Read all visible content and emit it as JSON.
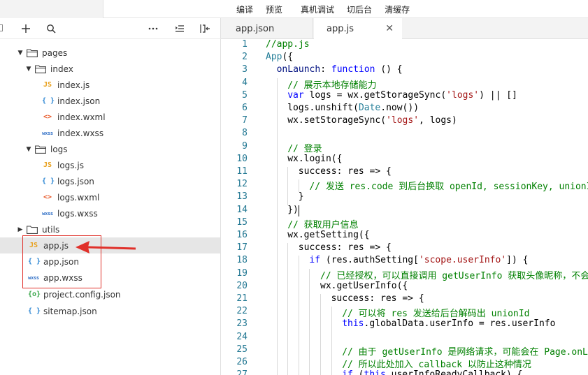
{
  "toolbar": {
    "menu": [
      "编译",
      "预览",
      "真机调试",
      "切后台",
      "清缓存"
    ]
  },
  "explorer_toolbar": {
    "icons": [
      "add-icon",
      "search-icon",
      "more-icon",
      "collapse-icon",
      "split-icon"
    ]
  },
  "explorer": {
    "tree": [
      {
        "label": "pages",
        "type": "folder",
        "depth": 0
      },
      {
        "label": "index",
        "type": "folder",
        "depth": 1
      },
      {
        "label": "index.js",
        "type": "js",
        "depth": 2
      },
      {
        "label": "index.json",
        "type": "json",
        "depth": 2
      },
      {
        "label": "index.wxml",
        "type": "wxml",
        "depth": 2
      },
      {
        "label": "index.wxss",
        "type": "wxss",
        "depth": 2
      },
      {
        "label": "logs",
        "type": "folder",
        "depth": 1
      },
      {
        "label": "logs.js",
        "type": "js",
        "depth": 2
      },
      {
        "label": "logs.json",
        "type": "json",
        "depth": 2
      },
      {
        "label": "logs.wxml",
        "type": "wxml",
        "depth": 2
      },
      {
        "label": "logs.wxss",
        "type": "wxss",
        "depth": 2
      },
      {
        "label": "utils",
        "type": "folder-closed",
        "depth": 0
      },
      {
        "label": "app.js",
        "type": "js",
        "depth": 0,
        "selected": true
      },
      {
        "label": "app.json",
        "type": "json",
        "depth": 0
      },
      {
        "label": "app.wxss",
        "type": "wxss",
        "depth": 0
      },
      {
        "label": "project.config.json",
        "type": "config",
        "depth": 0
      },
      {
        "label": "sitemap.json",
        "type": "json",
        "depth": 0
      }
    ],
    "icon_text": {
      "js": "JS",
      "json": "{ }",
      "wxml": "<>",
      "wxss": "wxss",
      "config": "{o}"
    }
  },
  "tabs": [
    {
      "label": "app.json",
      "active": false
    },
    {
      "label": "app.js",
      "active": true,
      "close": "✕"
    }
  ],
  "editor": {
    "lines": [
      {
        "n": "1",
        "ind": 0,
        "t": [
          [
            "c",
            "//app.js"
          ]
        ]
      },
      {
        "n": "2",
        "ind": 0,
        "t": [
          [
            "t",
            "App"
          ],
          [
            "",
            "({"
          ]
        ]
      },
      {
        "n": "3",
        "ind": 1,
        "t": [
          [
            "p",
            "onLaunch"
          ],
          [
            "",
            ": "
          ],
          [
            "k",
            "function"
          ],
          [
            "",
            " () {"
          ]
        ]
      },
      {
        "n": "4",
        "ind": 2,
        "t": [
          [
            "c",
            "// 展示本地存储能力"
          ]
        ]
      },
      {
        "n": "5",
        "ind": 2,
        "t": [
          [
            "k",
            "var"
          ],
          [
            "",
            " logs = wx.getStorageSync("
          ],
          [
            "s",
            "'logs'"
          ],
          [
            "",
            ") || []"
          ]
        ]
      },
      {
        "n": "6",
        "ind": 2,
        "t": [
          [
            "",
            "logs.unshift("
          ],
          [
            "t",
            "Date"
          ],
          [
            "",
            ".now())"
          ]
        ]
      },
      {
        "n": "7",
        "ind": 2,
        "t": [
          [
            "",
            "wx.setStorageSync("
          ],
          [
            "s",
            "'logs'"
          ],
          [
            "",
            ", logs)"
          ]
        ]
      },
      {
        "n": "8",
        "ind": 0,
        "t": []
      },
      {
        "n": "9",
        "ind": 2,
        "t": [
          [
            "c",
            "// 登录"
          ]
        ]
      },
      {
        "n": "10",
        "ind": 2,
        "t": [
          [
            "",
            "wx.login({"
          ]
        ]
      },
      {
        "n": "11",
        "ind": 3,
        "t": [
          [
            "",
            "success: res => {"
          ]
        ]
      },
      {
        "n": "12",
        "ind": 4,
        "t": [
          [
            "c",
            "// 发送 res.code 到后台换取 openId, sessionKey, unionId"
          ]
        ]
      },
      {
        "n": "13",
        "ind": 3,
        "t": [
          [
            "",
            "}"
          ]
        ]
      },
      {
        "n": "14",
        "ind": 2,
        "t": [
          [
            "",
            "})"
          ]
        ]
      },
      {
        "n": "15",
        "ind": 2,
        "t": [
          [
            "c",
            "// 获取用户信息"
          ]
        ]
      },
      {
        "n": "16",
        "ind": 2,
        "t": [
          [
            "",
            "wx.getSetting({"
          ]
        ]
      },
      {
        "n": "17",
        "ind": 3,
        "t": [
          [
            "",
            "success: res => {"
          ]
        ]
      },
      {
        "n": "18",
        "ind": 4,
        "t": [
          [
            "k",
            "if"
          ],
          [
            "",
            " (res.authSetting["
          ],
          [
            "s",
            "'scope.userInfo'"
          ],
          [
            "",
            "]) {"
          ]
        ]
      },
      {
        "n": "19",
        "ind": 5,
        "t": [
          [
            "c",
            "// 已经授权，可以直接调用 getUserInfo 获取头像昵称，不会弹框"
          ]
        ]
      },
      {
        "n": "20",
        "ind": 5,
        "t": [
          [
            "",
            "wx.getUserInfo({"
          ]
        ]
      },
      {
        "n": "21",
        "ind": 6,
        "t": [
          [
            "",
            "success: res => {"
          ]
        ]
      },
      {
        "n": "22",
        "ind": 7,
        "t": [
          [
            "c",
            "// 可以将 res 发送给后台解码出 unionId"
          ]
        ]
      },
      {
        "n": "23",
        "ind": 7,
        "t": [
          [
            "k",
            "this"
          ],
          [
            "",
            ".globalData.userInfo = res.userInfo"
          ]
        ]
      },
      {
        "n": "24",
        "ind": 0,
        "t": []
      },
      {
        "n": "25",
        "ind": 7,
        "t": [
          [
            "c",
            "// 由于 getUserInfo 是网络请求，可能会在 Page.onLoad 之后才返回"
          ]
        ]
      },
      {
        "n": "26",
        "ind": 7,
        "t": [
          [
            "c",
            "// 所以此处加入 callback 以防止这种情况"
          ]
        ]
      },
      {
        "n": "27",
        "ind": 7,
        "t": [
          [
            "k",
            "if"
          ],
          [
            "",
            " ("
          ],
          [
            "k",
            "this"
          ],
          [
            "",
            ".userInfoReadyCallback) {"
          ]
        ]
      }
    ]
  }
}
